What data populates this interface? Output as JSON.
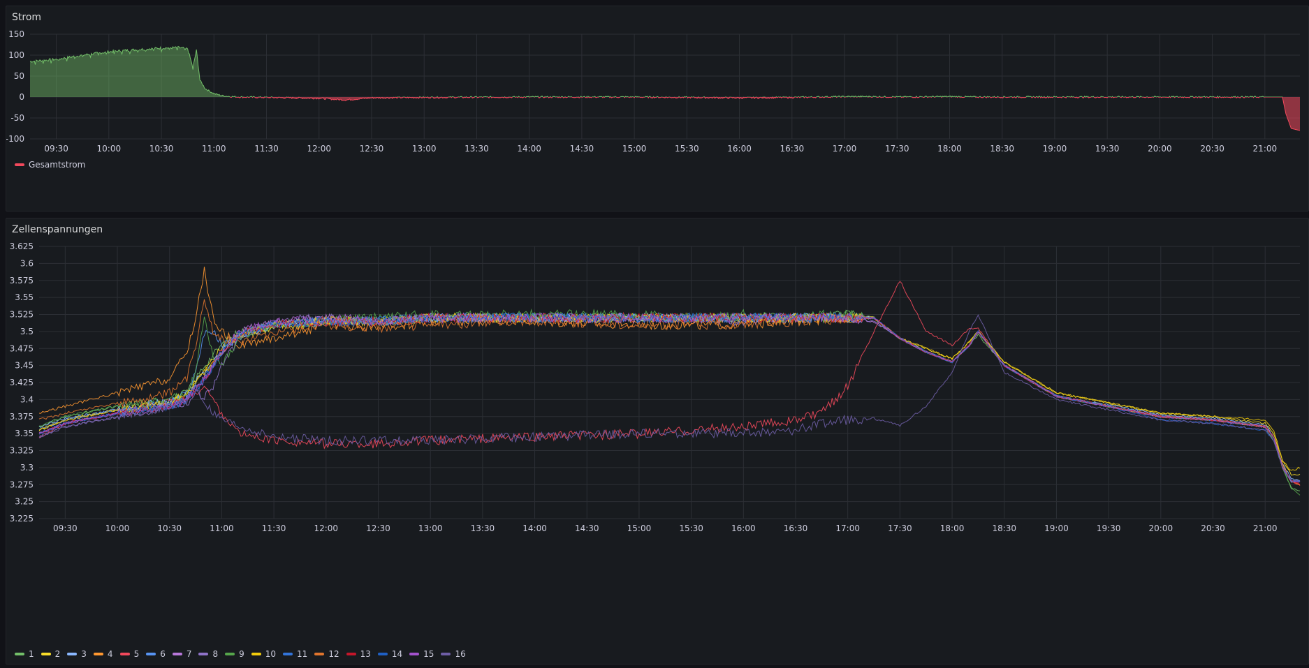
{
  "panels": {
    "strom": {
      "title": "Strom"
    },
    "zellen": {
      "title": "Zellenspannungen"
    }
  },
  "chart_data": [
    {
      "type": "area",
      "title": "Strom",
      "ylim": [
        -100,
        150
      ],
      "yticks": [
        "150",
        "100",
        "50",
        "0",
        "-50",
        "-100"
      ],
      "xlim": [
        "09:15",
        "21:20"
      ],
      "xticks": [
        "09:30",
        "10:00",
        "10:30",
        "11:00",
        "11:30",
        "12:00",
        "12:30",
        "13:00",
        "13:30",
        "14:00",
        "14:30",
        "15:00",
        "15:30",
        "16:00",
        "16:30",
        "17:00",
        "17:30",
        "18:00",
        "18:30",
        "19:00",
        "19:30",
        "20:00",
        "20:30",
        "21:00"
      ],
      "grid": true,
      "legend_position": "bottom-left",
      "series": [
        {
          "name": "Gesamtstrom",
          "color": "#f2495c",
          "positive_fill": "#73bf69",
          "negative_fill": "#f2495c",
          "x": [
            "09:15",
            "09:30",
            "09:45",
            "10:00",
            "10:15",
            "10:30",
            "10:40",
            "10:45",
            "10:48",
            "10:50",
            "10:52",
            "10:55",
            "11:00",
            "11:05",
            "11:10",
            "11:15",
            "11:30",
            "12:00",
            "12:15",
            "12:30",
            "13:00",
            "14:00",
            "15:00",
            "16:00",
            "16:30",
            "17:00",
            "17:15",
            "17:30",
            "18:00",
            "18:15",
            "19:00",
            "20:00",
            "21:00",
            "21:05",
            "21:10",
            "21:12",
            "21:15",
            "21:20"
          ],
          "y": [
            85,
            90,
            100,
            108,
            113,
            117,
            118,
            115,
            70,
            112,
            40,
            20,
            8,
            3,
            1,
            0,
            -1,
            -3,
            -7,
            -2,
            -1,
            0,
            0,
            -2,
            -1,
            1,
            1,
            0,
            1,
            0,
            0,
            0,
            0,
            0,
            0,
            -40,
            -75,
            -80
          ]
        }
      ]
    },
    {
      "type": "line",
      "title": "Zellenspannungen",
      "ylim": [
        3.225,
        3.625
      ],
      "yticks": [
        "3.625",
        "3.6",
        "3.575",
        "3.55",
        "3.525",
        "3.5",
        "3.475",
        "3.45",
        "3.425",
        "3.4",
        "3.375",
        "3.35",
        "3.325",
        "3.3",
        "3.275",
        "3.25",
        "3.225"
      ],
      "xlim": [
        "09:15",
        "21:20"
      ],
      "xticks": [
        "09:30",
        "10:00",
        "10:30",
        "11:00",
        "11:30",
        "12:00",
        "12:30",
        "13:00",
        "13:30",
        "14:00",
        "14:30",
        "15:00",
        "15:30",
        "16:00",
        "16:30",
        "17:00",
        "17:30",
        "18:00",
        "18:30",
        "19:00",
        "19:30",
        "20:00",
        "20:30",
        "21:00"
      ],
      "grid": true,
      "legend_position": "bottom-left",
      "x": [
        "09:15",
        "09:30",
        "10:00",
        "10:15",
        "10:30",
        "10:40",
        "10:45",
        "10:50",
        "10:55",
        "11:00",
        "11:10",
        "11:30",
        "12:00",
        "12:30",
        "13:00",
        "14:00",
        "15:00",
        "15:30",
        "16:00",
        "16:30",
        "16:45",
        "17:00",
        "17:15",
        "17:30",
        "17:45",
        "18:00",
        "18:10",
        "18:15",
        "18:30",
        "19:00",
        "19:30",
        "20:00",
        "20:30",
        "21:00",
        "21:05",
        "21:10",
        "21:15",
        "21:20"
      ],
      "series": [
        {
          "name": "1",
          "color": "#73bf69",
          "values": [
            3.36,
            3.375,
            3.39,
            3.395,
            3.4,
            3.41,
            3.43,
            3.45,
            3.465,
            3.48,
            3.5,
            3.51,
            3.515,
            3.515,
            3.52,
            3.52,
            3.52,
            3.52,
            3.52,
            3.52,
            3.52,
            3.525,
            3.52,
            3.49,
            3.47,
            3.455,
            3.48,
            3.495,
            3.45,
            3.405,
            3.39,
            3.375,
            3.37,
            3.36,
            3.34,
            3.3,
            3.27,
            3.265
          ]
        },
        {
          "name": "2",
          "color": "#fade2a",
          "values": [
            3.355,
            3.37,
            3.385,
            3.39,
            3.395,
            3.41,
            3.43,
            3.44,
            3.46,
            3.475,
            3.495,
            3.505,
            3.515,
            3.515,
            3.52,
            3.52,
            3.52,
            3.52,
            3.52,
            3.52,
            3.52,
            3.52,
            3.52,
            3.49,
            3.475,
            3.46,
            3.485,
            3.5,
            3.455,
            3.41,
            3.395,
            3.38,
            3.375,
            3.365,
            3.35,
            3.31,
            3.29,
            3.29
          ]
        },
        {
          "name": "3",
          "color": "#8ab8ff",
          "values": [
            3.36,
            3.372,
            3.386,
            3.392,
            3.397,
            3.405,
            3.425,
            3.44,
            3.455,
            3.47,
            3.495,
            3.51,
            3.515,
            3.515,
            3.52,
            3.52,
            3.52,
            3.52,
            3.52,
            3.52,
            3.52,
            3.52,
            3.52,
            3.49,
            3.47,
            3.455,
            3.48,
            3.5,
            3.45,
            3.405,
            3.392,
            3.378,
            3.373,
            3.363,
            3.345,
            3.305,
            3.285,
            3.28
          ]
        },
        {
          "name": "4",
          "color": "#ff9830",
          "values": [
            3.38,
            3.39,
            3.41,
            3.42,
            3.43,
            3.47,
            3.52,
            3.59,
            3.52,
            3.5,
            3.48,
            3.49,
            3.51,
            3.505,
            3.515,
            3.515,
            3.51,
            3.51,
            3.51,
            3.515,
            3.515,
            3.52,
            3.52,
            3.49,
            3.47,
            3.455,
            3.48,
            3.5,
            3.45,
            3.405,
            3.39,
            3.375,
            3.37,
            3.36,
            3.345,
            3.305,
            3.28,
            3.275
          ]
        },
        {
          "name": "5",
          "color": "#f2495c",
          "values": [
            3.345,
            3.365,
            3.38,
            3.39,
            3.395,
            3.4,
            3.41,
            3.42,
            3.4,
            3.38,
            3.35,
            3.34,
            3.335,
            3.335,
            3.34,
            3.345,
            3.35,
            3.355,
            3.36,
            3.37,
            3.38,
            3.42,
            3.5,
            3.575,
            3.5,
            3.48,
            3.505,
            3.505,
            3.45,
            3.405,
            3.39,
            3.375,
            3.37,
            3.36,
            3.345,
            3.3,
            3.28,
            3.275
          ]
        },
        {
          "name": "6",
          "color": "#5794f2",
          "values": [
            3.355,
            3.37,
            3.385,
            3.39,
            3.395,
            3.41,
            3.44,
            3.5,
            3.5,
            3.48,
            3.49,
            3.51,
            3.515,
            3.515,
            3.52,
            3.52,
            3.52,
            3.52,
            3.52,
            3.52,
            3.52,
            3.52,
            3.52,
            3.49,
            3.47,
            3.455,
            3.48,
            3.5,
            3.45,
            3.405,
            3.39,
            3.375,
            3.37,
            3.36,
            3.345,
            3.3,
            3.28,
            3.28
          ]
        },
        {
          "name": "7",
          "color": "#b877d9",
          "values": [
            3.35,
            3.365,
            3.38,
            3.385,
            3.39,
            3.4,
            3.42,
            3.43,
            3.45,
            3.47,
            3.5,
            3.515,
            3.52,
            3.515,
            3.52,
            3.52,
            3.52,
            3.52,
            3.52,
            3.52,
            3.52,
            3.52,
            3.515,
            3.49,
            3.47,
            3.455,
            3.48,
            3.5,
            3.45,
            3.405,
            3.39,
            3.375,
            3.37,
            3.36,
            3.345,
            3.3,
            3.28,
            3.28
          ]
        },
        {
          "name": "8",
          "color": "#8f73c9",
          "values": [
            3.345,
            3.36,
            3.375,
            3.382,
            3.39,
            3.395,
            3.41,
            3.405,
            3.42,
            3.45,
            3.49,
            3.515,
            3.52,
            3.515,
            3.52,
            3.52,
            3.52,
            3.52,
            3.515,
            3.52,
            3.52,
            3.52,
            3.515,
            3.49,
            3.47,
            3.455,
            3.48,
            3.5,
            3.45,
            3.405,
            3.39,
            3.375,
            3.37,
            3.36,
            3.345,
            3.3,
            3.28,
            3.28
          ]
        },
        {
          "name": "9",
          "color": "#56a64b",
          "values": [
            3.36,
            3.375,
            3.39,
            3.395,
            3.4,
            3.41,
            3.44,
            3.52,
            3.46,
            3.45,
            3.49,
            3.51,
            3.515,
            3.52,
            3.525,
            3.525,
            3.525,
            3.52,
            3.525,
            3.52,
            3.525,
            3.525,
            3.52,
            3.49,
            3.47,
            3.455,
            3.48,
            3.5,
            3.45,
            3.405,
            3.39,
            3.375,
            3.37,
            3.36,
            3.345,
            3.3,
            3.27,
            3.26
          ]
        },
        {
          "name": "10",
          "color": "#f2cc0c",
          "values": [
            3.355,
            3.37,
            3.385,
            3.39,
            3.395,
            3.405,
            3.42,
            3.44,
            3.455,
            3.47,
            3.495,
            3.51,
            3.515,
            3.515,
            3.52,
            3.52,
            3.52,
            3.52,
            3.52,
            3.52,
            3.52,
            3.52,
            3.52,
            3.49,
            3.475,
            3.46,
            3.485,
            3.5,
            3.455,
            3.41,
            3.395,
            3.38,
            3.375,
            3.37,
            3.355,
            3.31,
            3.295,
            3.3
          ]
        },
        {
          "name": "11",
          "color": "#3274d9",
          "values": [
            3.35,
            3.365,
            3.38,
            3.385,
            3.39,
            3.4,
            3.415,
            3.43,
            3.45,
            3.47,
            3.495,
            3.51,
            3.515,
            3.515,
            3.52,
            3.52,
            3.52,
            3.52,
            3.52,
            3.52,
            3.52,
            3.52,
            3.52,
            3.49,
            3.47,
            3.455,
            3.48,
            3.5,
            3.45,
            3.405,
            3.39,
            3.375,
            3.37,
            3.36,
            3.345,
            3.3,
            3.28,
            3.28
          ]
        },
        {
          "name": "12",
          "color": "#e0752d",
          "values": [
            3.37,
            3.38,
            3.395,
            3.4,
            3.41,
            3.43,
            3.48,
            3.55,
            3.5,
            3.49,
            3.485,
            3.5,
            3.51,
            3.505,
            3.51,
            3.515,
            3.51,
            3.51,
            3.51,
            3.515,
            3.515,
            3.52,
            3.52,
            3.49,
            3.47,
            3.455,
            3.48,
            3.5,
            3.45,
            3.405,
            3.39,
            3.375,
            3.37,
            3.36,
            3.345,
            3.3,
            3.28,
            3.275
          ]
        },
        {
          "name": "13",
          "color": "#c4162a",
          "values": [
            3.35,
            3.365,
            3.38,
            3.385,
            3.39,
            3.4,
            3.415,
            3.43,
            3.45,
            3.47,
            3.495,
            3.51,
            3.515,
            3.515,
            3.52,
            3.52,
            3.52,
            3.52,
            3.52,
            3.52,
            3.52,
            3.52,
            3.52,
            3.49,
            3.47,
            3.455,
            3.48,
            3.5,
            3.45,
            3.405,
            3.39,
            3.375,
            3.37,
            3.36,
            3.345,
            3.3,
            3.28,
            3.275
          ]
        },
        {
          "name": "14",
          "color": "#1f60c4",
          "values": [
            3.35,
            3.365,
            3.38,
            3.385,
            3.39,
            3.4,
            3.415,
            3.43,
            3.45,
            3.47,
            3.495,
            3.51,
            3.515,
            3.515,
            3.52,
            3.52,
            3.52,
            3.52,
            3.52,
            3.52,
            3.52,
            3.52,
            3.52,
            3.49,
            3.47,
            3.455,
            3.48,
            3.5,
            3.45,
            3.405,
            3.39,
            3.37,
            3.365,
            3.355,
            3.34,
            3.3,
            3.28,
            3.28
          ]
        },
        {
          "name": "15",
          "color": "#a352cc",
          "values": [
            3.35,
            3.365,
            3.38,
            3.385,
            3.39,
            3.4,
            3.415,
            3.43,
            3.45,
            3.47,
            3.5,
            3.515,
            3.515,
            3.515,
            3.52,
            3.52,
            3.52,
            3.52,
            3.52,
            3.52,
            3.52,
            3.52,
            3.52,
            3.49,
            3.47,
            3.455,
            3.48,
            3.5,
            3.45,
            3.405,
            3.39,
            3.375,
            3.37,
            3.36,
            3.345,
            3.3,
            3.28,
            3.28
          ]
        },
        {
          "name": "16",
          "color": "#6e5ea6",
          "values": [
            3.345,
            3.36,
            3.375,
            3.382,
            3.39,
            3.4,
            3.42,
            3.395,
            3.38,
            3.37,
            3.36,
            3.345,
            3.34,
            3.34,
            3.34,
            3.345,
            3.35,
            3.35,
            3.35,
            3.355,
            3.365,
            3.37,
            3.372,
            3.362,
            3.39,
            3.44,
            3.5,
            3.525,
            3.44,
            3.4,
            3.385,
            3.37,
            3.365,
            3.355,
            3.34,
            3.3,
            3.28,
            3.28
          ]
        }
      ]
    }
  ]
}
